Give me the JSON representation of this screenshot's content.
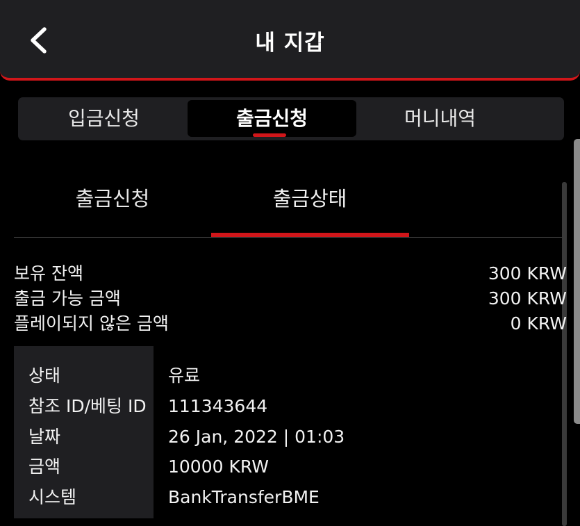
{
  "header": {
    "title": "내 지갑",
    "back_icon": "chevron-left-icon"
  },
  "top_tabs": [
    {
      "label": "입금신청",
      "active": false
    },
    {
      "label": "출금신청",
      "active": true
    },
    {
      "label": "머니내역",
      "active": false
    }
  ],
  "sub_tabs": [
    {
      "label": "출금신청",
      "active": false
    },
    {
      "label": "출금상태",
      "active": true
    }
  ],
  "balances": [
    {
      "label": "보유 잔액",
      "value": "300 KRW"
    },
    {
      "label": "출금 가능 금액",
      "value": "300 KRW"
    },
    {
      "label": "플레이되지 않은 금액",
      "value": "0 KRW"
    }
  ],
  "details": [
    {
      "label": "상태",
      "value": "유료"
    },
    {
      "label": "참조 ID/베팅 ID",
      "value": "111343644"
    },
    {
      "label": "날짜",
      "value": "26 Jan, 2022 | 01:03"
    },
    {
      "label": "금액",
      "value": "10000 KRW"
    },
    {
      "label": "시스템",
      "value": "BankTransferBME"
    }
  ],
  "colors": {
    "accent": "#d0161a",
    "panel": "#1f1f22",
    "background": "#000000"
  }
}
